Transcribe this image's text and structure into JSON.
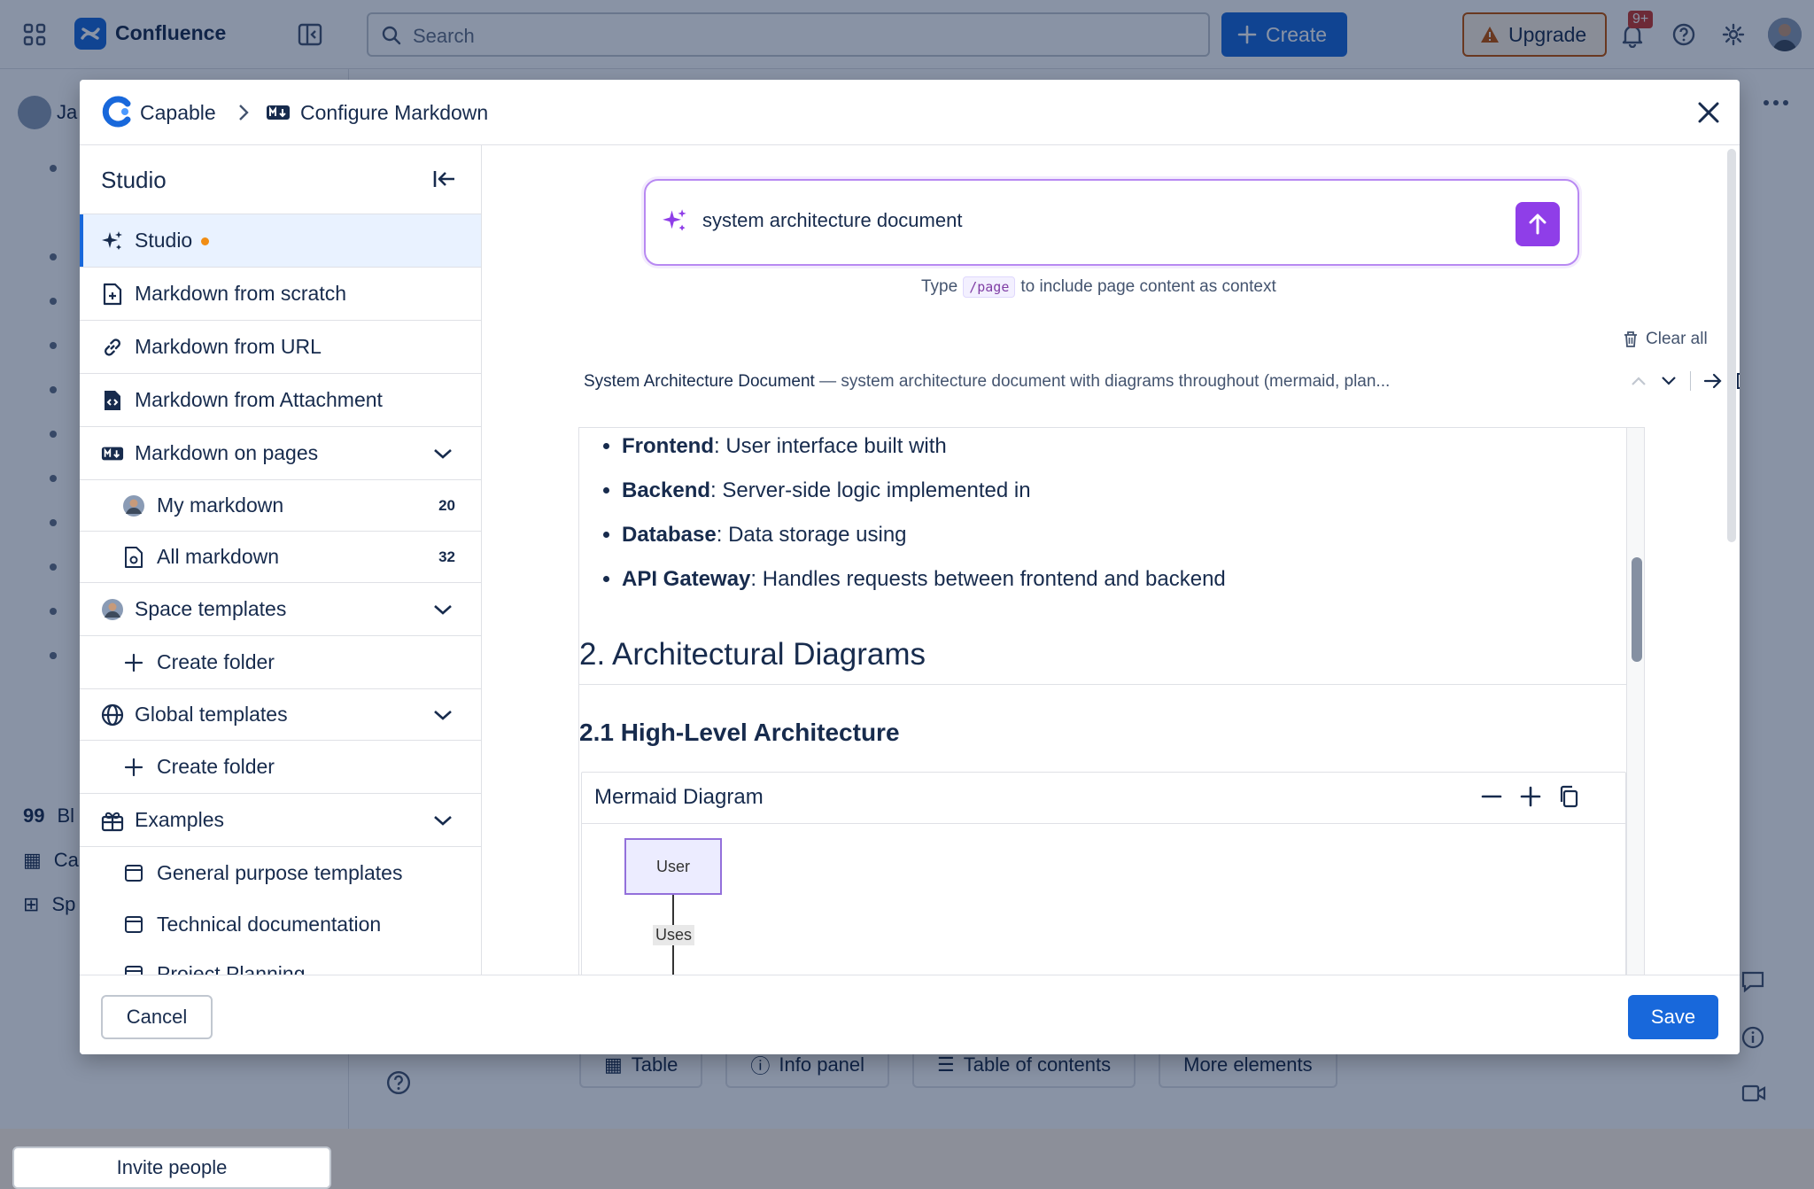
{
  "topbar": {
    "brand": "Confluence",
    "search_placeholder": "Search",
    "create_label": "Create",
    "upgrade_label": "Upgrade",
    "notifications_badge": "9+"
  },
  "background": {
    "sidebar_user_fragment": "Ja",
    "sidebar_partial_items": [
      "Bl",
      "Ca",
      "Sp"
    ],
    "invite_label": "Invite people",
    "toolbar": [
      "Table",
      "Info panel",
      "Table of contents",
      "More elements"
    ]
  },
  "modal": {
    "breadcrumb_app": "Capable",
    "breadcrumb_page": "Configure Markdown",
    "studio": {
      "title": "Studio",
      "items": [
        {
          "label": "Studio"
        },
        {
          "label": "Markdown from scratch"
        },
        {
          "label": "Markdown from URL"
        },
        {
          "label": "Markdown from Attachment"
        },
        {
          "label": "Markdown on pages"
        },
        {
          "label": "My markdown",
          "count": "20"
        },
        {
          "label": "All markdown",
          "count": "32"
        },
        {
          "label": "Space templates"
        },
        {
          "label": "Create folder"
        },
        {
          "label": "Global templates"
        },
        {
          "label": "Create folder"
        },
        {
          "label": "Examples"
        },
        {
          "label": "General purpose templates"
        },
        {
          "label": "Technical documentation"
        },
        {
          "label": "Project Planning"
        }
      ]
    },
    "prompt": {
      "value": "system architecture document",
      "hint_before": "Type",
      "hint_code": "/page",
      "hint_after": "to include page content as context"
    },
    "clear_all": "Clear all",
    "doc": {
      "title": "System Architecture Document",
      "subtitle": "— system architecture document with diagrams throughout (mermaid, plan..."
    },
    "preview": {
      "bullets": [
        {
          "term": "Frontend",
          "text": ": User interface built with"
        },
        {
          "term": "Backend",
          "text": ": Server-side logic implemented in"
        },
        {
          "term": "Database",
          "text": ": Data storage using"
        },
        {
          "term": "API Gateway",
          "text": ": Handles requests between frontend and backend"
        }
      ],
      "h2": "2. Architectural Diagrams",
      "h3": "2.1 High-Level Architecture",
      "diagram_title": "Mermaid Diagram",
      "node_user": "User",
      "edge_label": "Uses"
    },
    "footer": {
      "cancel": "Cancel",
      "save": "Save"
    }
  },
  "colors": {
    "primary": "#1868db",
    "accent_purple": "#8f3ee8",
    "active_bg": "#e9f2ff",
    "status_dot": "#f18d13"
  }
}
